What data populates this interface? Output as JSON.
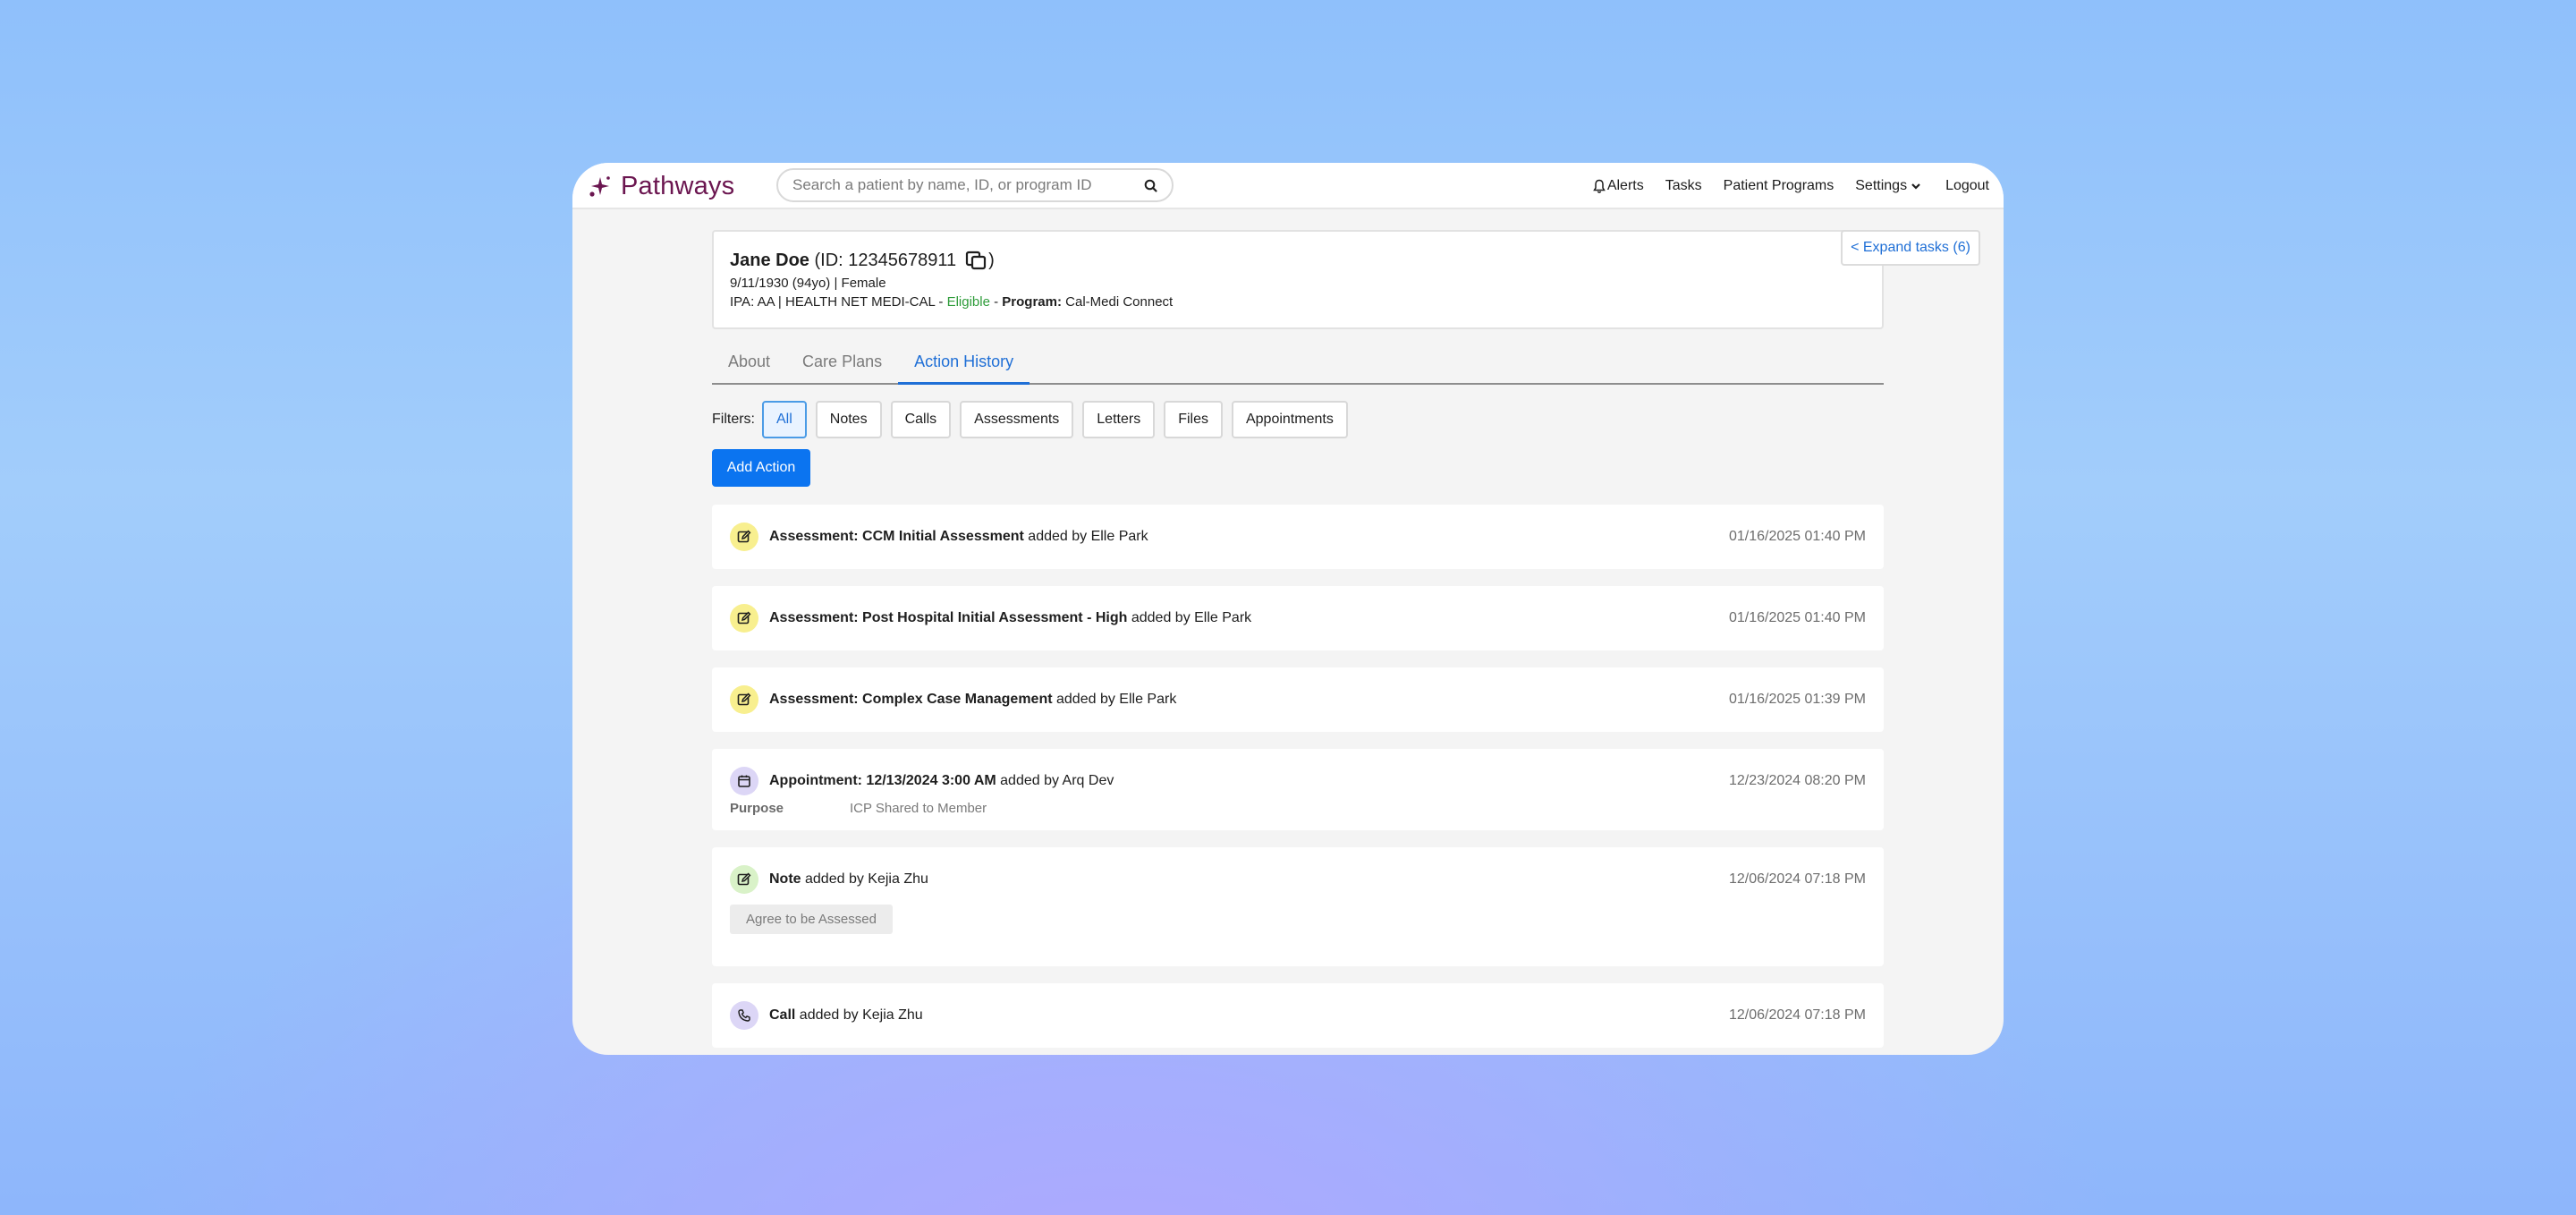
{
  "brand": {
    "name": "Pathways",
    "color": "#6b1650"
  },
  "search": {
    "placeholder": "Search a patient by name, ID, or program ID"
  },
  "nav": {
    "alerts": "Alerts",
    "tasks": "Tasks",
    "patient_programs": "Patient Programs",
    "settings": "Settings",
    "logout": "Logout"
  },
  "patient": {
    "name": "Jane Doe",
    "id_text": "(ID: 12345678911",
    "id_close": ")",
    "dob_line": "9/11/1930 (94yo) | Female",
    "ipa_prefix": "IPA: AA | HEALTH NET MEDI-CAL - ",
    "eligibility": "Eligible",
    "separator": " - ",
    "program_label": "Program:",
    "program_value": " Cal-Medi Connect"
  },
  "expand_tasks": "< Expand tasks (6)",
  "tabs": [
    {
      "label": "About",
      "active": false
    },
    {
      "label": "Care Plans",
      "active": false
    },
    {
      "label": "Action History",
      "active": true
    }
  ],
  "filters": {
    "label": "Filters:",
    "options": [
      "All",
      "Notes",
      "Calls",
      "Assessments",
      "Letters",
      "Files",
      "Appointments"
    ],
    "selected": "All"
  },
  "add_action": "Add Action",
  "actions": [
    {
      "type": "assessment",
      "title": "Assessment: CCM Initial Assessment",
      "by": " added by Elle Park",
      "time": "01/16/2025 01:40 PM"
    },
    {
      "type": "assessment",
      "title": "Assessment: Post Hospital Initial Assessment - High",
      "by": " added by Elle Park",
      "time": "01/16/2025 01:40 PM"
    },
    {
      "type": "assessment",
      "title": "Assessment: Complex Case Management",
      "by": " added by Elle Park",
      "time": "01/16/2025 01:39 PM"
    },
    {
      "type": "appointment",
      "title": "Appointment: 12/13/2024 3:00 AM",
      "by": " added by Arq Dev",
      "time": "12/23/2024 08:20 PM",
      "detail_label": "Purpose",
      "detail_value": "ICP Shared to Member"
    },
    {
      "type": "note",
      "title": "Note",
      "by": " added by Kejia Zhu",
      "time": "12/06/2024 07:18 PM",
      "tag": "Agree to be Assessed"
    },
    {
      "type": "call",
      "title": "Call",
      "by": " added by Kejia Zhu",
      "time": "12/06/2024 07:18 PM"
    }
  ],
  "colors": {
    "accent": "#1f6fd6",
    "primary_button": "#0b74f0",
    "eligible": "#2e9c3a",
    "assessment_badge": "#f8ef8f",
    "appointment_badge": "#dcd6f6",
    "note_badge": "#d9f2c8"
  },
  "icons": {
    "logo": "sparkle-logo-icon",
    "search": "search-icon",
    "alerts": "bell-icon",
    "settings": "chevron-down-icon",
    "copy": "copy-icon",
    "assessment": "edit-icon",
    "appointment": "calendar-icon",
    "note": "edit-icon",
    "call": "phone-icon"
  }
}
